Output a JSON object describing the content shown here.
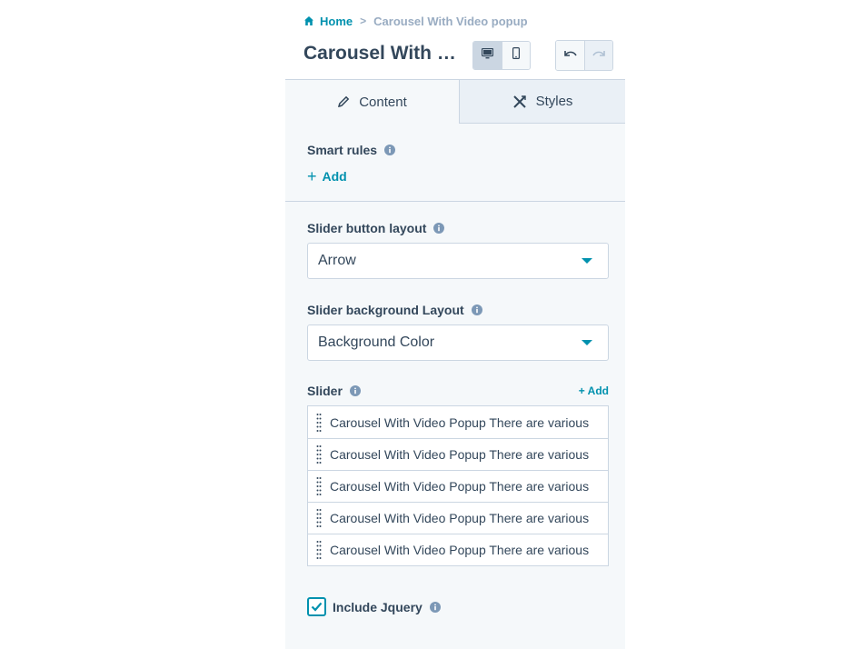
{
  "breadcrumb": {
    "home_label": "Home",
    "separator": ">",
    "current": "Carousel With Video popup"
  },
  "header": {
    "title": "Carousel With Video popup",
    "device_desktop_icon": "desktop-icon",
    "device_mobile_icon": "mobile-icon",
    "undo_icon": "undo-icon",
    "redo_icon": "redo-icon"
  },
  "tabs": [
    {
      "label": "Content",
      "icon": "pencil-icon",
      "active": true
    },
    {
      "label": "Styles",
      "icon": "styles-icon",
      "active": false
    }
  ],
  "smart_rules": {
    "label": "Smart rules",
    "add_label": "Add"
  },
  "slider_button_layout": {
    "label": "Slider button layout",
    "value": "Arrow"
  },
  "slider_background_layout": {
    "label": "Slider background Layout",
    "value": "Background Color"
  },
  "slider": {
    "label": "Slider",
    "add_label": "+ Add",
    "items": [
      "Carousel With Video Popup There are various",
      "Carousel With Video Popup There are various",
      "Carousel With Video Popup There are various",
      "Carousel With Video Popup There are various",
      "Carousel With Video Popup There are various"
    ]
  },
  "include_jquery": {
    "label": "Include Jquery",
    "checked": true
  },
  "colors": {
    "accent": "#0091ae",
    "text": "#33475b",
    "muted": "#99acc2",
    "border": "#cbd6e2",
    "panel_bg": "#f5f8fa"
  }
}
